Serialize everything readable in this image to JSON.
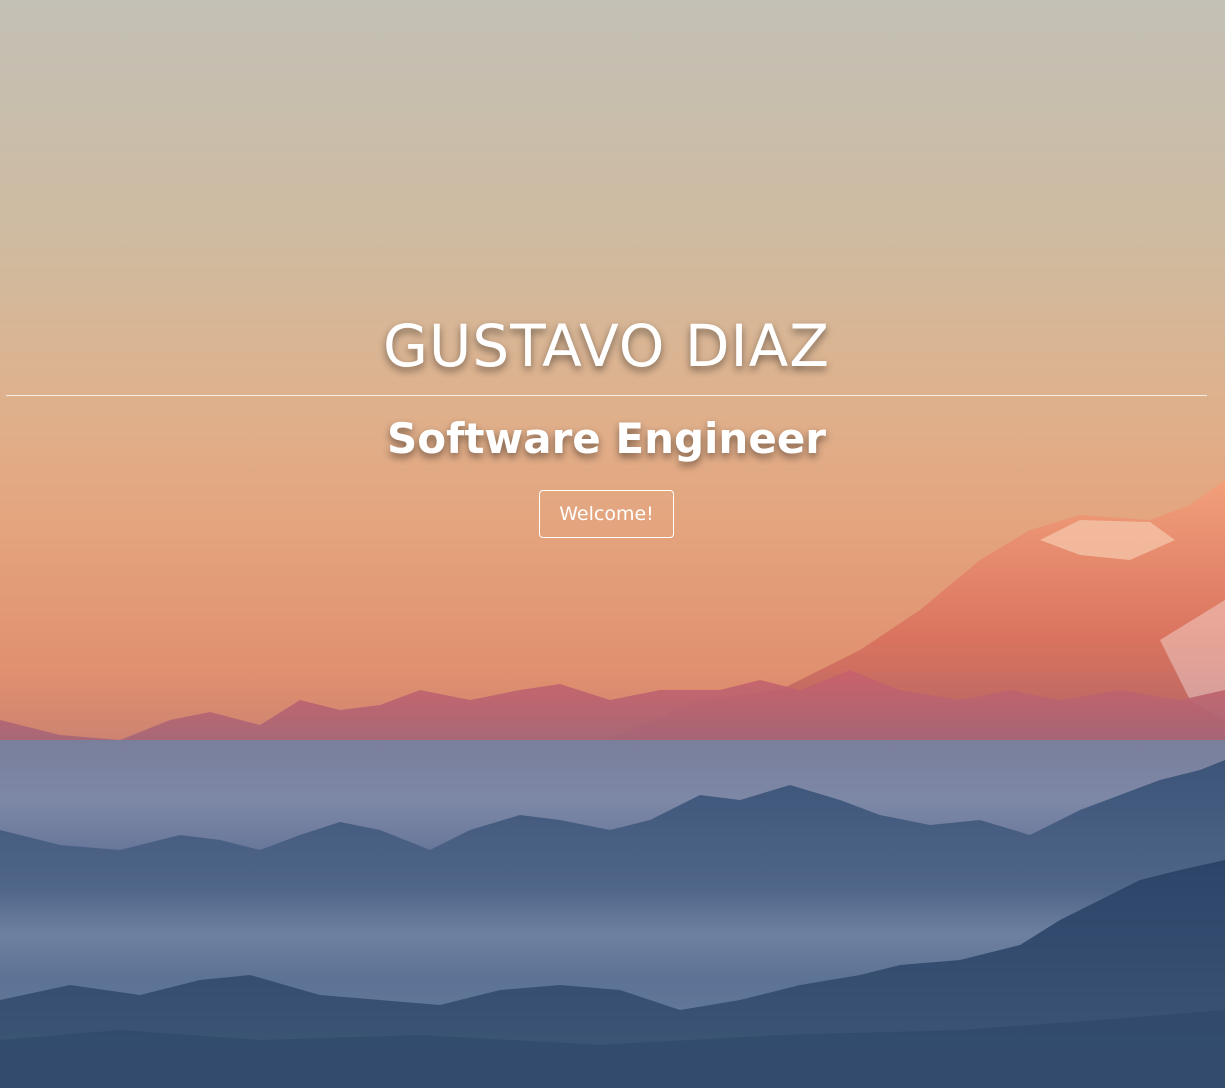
{
  "hero": {
    "name": "GUSTAVO DIAZ",
    "role": "Software Engineer",
    "cta_label": "Welcome!"
  },
  "background": {
    "image": "sunset-mountains",
    "sky_top_color": "#c4c0b5",
    "sky_mid_color": "#e5b084",
    "sky_low_color": "#df8f6e",
    "peak_color": "#e6805f",
    "haze_color": "#6f7fa0",
    "ridge_color": "#2f4a72"
  }
}
